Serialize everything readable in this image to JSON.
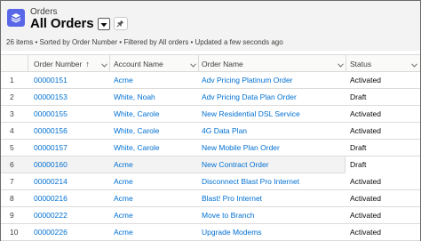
{
  "header": {
    "object_label": "Orders",
    "list_view_title": "All Orders",
    "obj_icon": "orders-icon",
    "dropdown_icon": "chevron-down-icon",
    "pin_icon": "pin-icon"
  },
  "meta_text": "26 items • Sorted by Order Number • Filtered by All orders • Updated a few seconds ago",
  "columns": [
    {
      "label": "Order Number",
      "sorted": "ascending"
    },
    {
      "label": "Account Name"
    },
    {
      "label": "Order Name"
    },
    {
      "label": "Status"
    }
  ],
  "sort_arrow": "↑",
  "rows": [
    {
      "n": "1",
      "order_number": "00000151",
      "account": "Acme",
      "order_name": "Adv Pricing Platinum Order",
      "status": "Activated"
    },
    {
      "n": "2",
      "order_number": "00000153",
      "account": "White, Noah",
      "order_name": "Adv Pricing Data Plan Order",
      "status": "Draft"
    },
    {
      "n": "3",
      "order_number": "00000155",
      "account": "White, Carole",
      "order_name": "New Residential DSL Service",
      "status": "Activated"
    },
    {
      "n": "4",
      "order_number": "00000156",
      "account": "White, Carole",
      "order_name": "4G Data Plan",
      "status": "Activated"
    },
    {
      "n": "5",
      "order_number": "00000157",
      "account": "White, Carole",
      "order_name": "New Mobile Plan Order",
      "status": "Draft"
    },
    {
      "n": "6",
      "order_number": "00000160",
      "account": "Acme",
      "order_name": "New Contract Order",
      "status": "Draft"
    },
    {
      "n": "7",
      "order_number": "00000214",
      "account": "Acme",
      "order_name": "Disconnect Blast Pro Internet",
      "status": "Activated"
    },
    {
      "n": "8",
      "order_number": "00000216",
      "account": "Acme",
      "order_name": "Blast! Pro Internet",
      "status": "Activated"
    },
    {
      "n": "9",
      "order_number": "00000222",
      "account": "Acme",
      "order_name": "Move to Branch",
      "status": "Activated"
    },
    {
      "n": "10",
      "order_number": "00000226",
      "account": "Acme",
      "order_name": "Upgrade Modems",
      "status": "Activated"
    }
  ],
  "colors": {
    "link": "#0070d2",
    "icon_bg": "#5867e8",
    "header_bg": "#f3f3f3"
  }
}
